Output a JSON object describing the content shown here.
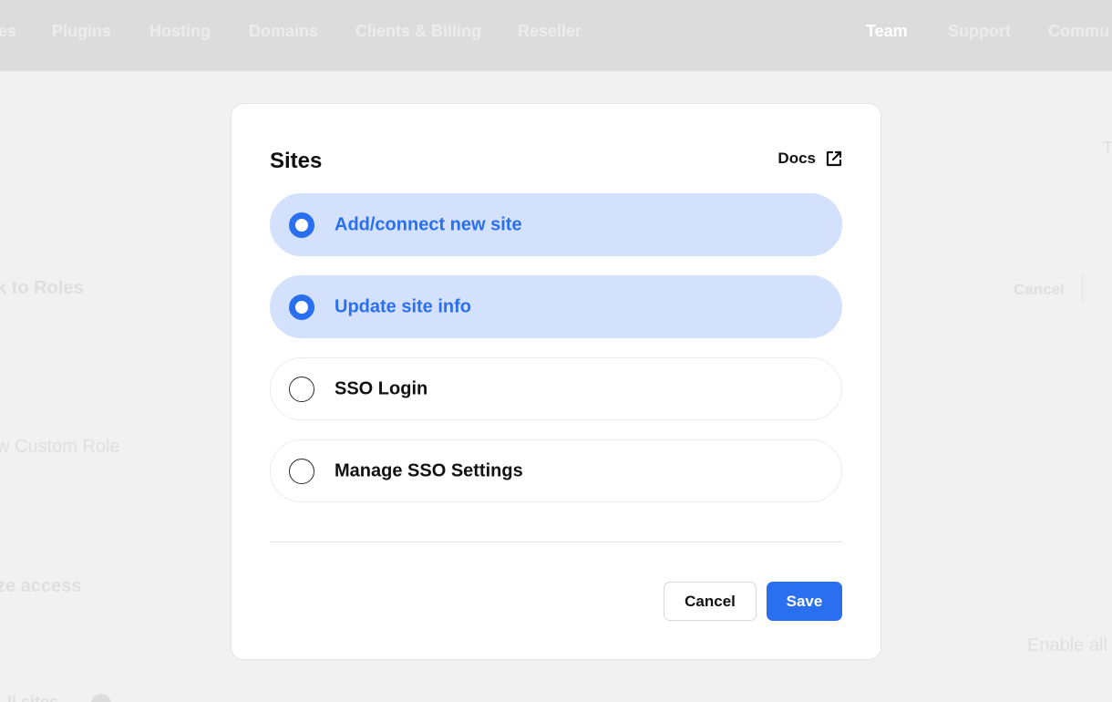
{
  "top_nav": {
    "items": [
      {
        "label": "es",
        "active": false
      },
      {
        "label": "Plugins",
        "active": false
      },
      {
        "label": "Hosting",
        "active": false
      },
      {
        "label": "Domains",
        "active": false
      },
      {
        "label": "Clients & Billing",
        "active": false
      },
      {
        "label": "Reseller",
        "active": false
      },
      {
        "label": "Team",
        "active": true
      },
      {
        "label": "Support",
        "active": false
      },
      {
        "label": "Commu",
        "active": false
      }
    ]
  },
  "background": {
    "back_link": "k to Roles",
    "custom_role": "w Custom Role",
    "access_heading": "ze access",
    "sites_label": "ll sites",
    "cancel_label": "Cancel",
    "t_label": "T",
    "enable_all": "Enable all"
  },
  "modal": {
    "title": "Sites",
    "docs_label": "Docs",
    "options": [
      {
        "label": "Add/connect new site",
        "selected": true
      },
      {
        "label": "Update site info",
        "selected": true
      },
      {
        "label": "SSO Login",
        "selected": false
      },
      {
        "label": "Manage SSO Settings",
        "selected": false
      }
    ],
    "cancel_label": "Cancel",
    "save_label": "Save"
  },
  "colors": {
    "accent": "#2a6ff0",
    "selected_bg": "#d3e1fc",
    "overlay_bg": "#f1f1f1"
  },
  "icons": {
    "docs": "external-link-icon"
  }
}
